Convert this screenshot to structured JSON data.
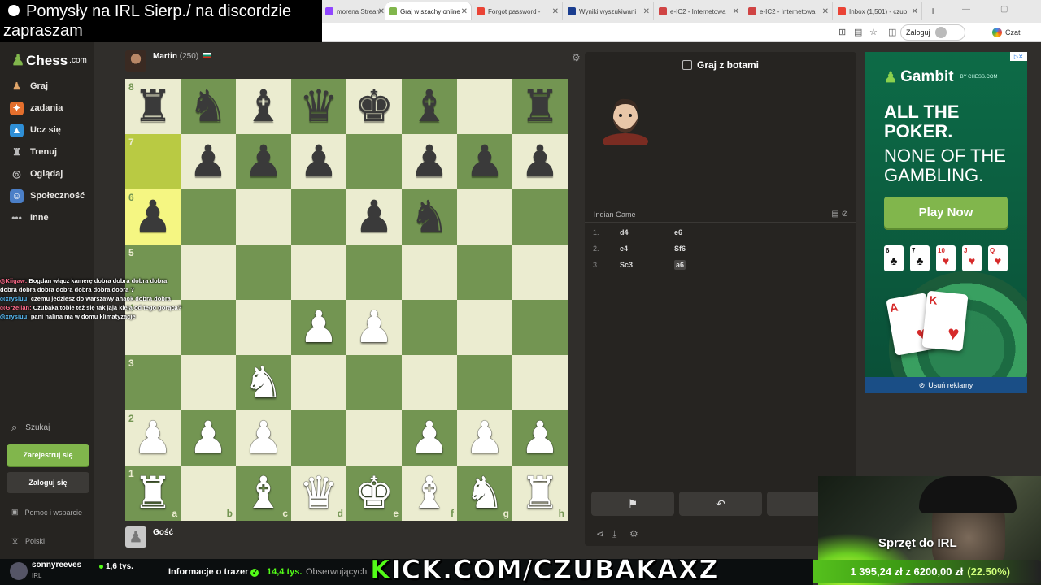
{
  "browser": {
    "tabs": [
      {
        "label": "morena Stream",
        "favicon_color": "#9146ff"
      },
      {
        "label": "Graj w szachy online",
        "favicon_color": "#81b64c",
        "active": true
      },
      {
        "label": "Forgot password - ",
        "favicon_color": "#ea4335"
      },
      {
        "label": "Wyniki wyszukiwani",
        "favicon_color": "#1a3d8f"
      },
      {
        "label": "e-IC2 - Internetowa",
        "favicon_color": "#d04444"
      },
      {
        "label": "e-IC2 - Internetowa",
        "favicon_color": "#d04444"
      },
      {
        "label": "Inbox (1,501) - czub",
        "favicon_color": "#ea4335"
      }
    ],
    "login_label": "Zaloguj",
    "chat_label": "Czat"
  },
  "stream_title": "Pomysły na IRL Sierp./ na discordzie zapraszam",
  "sidebar": {
    "logo": "Chess",
    "logo_suffix": ".com",
    "items": [
      {
        "label": "Graj",
        "color": "#e8e6e3"
      },
      {
        "label": "zadania",
        "color": "#e8e6e3"
      },
      {
        "label": "Ucz się",
        "color": "#e8e6e3"
      },
      {
        "label": "Trenuj",
        "color": "#e8e6e3"
      },
      {
        "label": "Oglądaj",
        "color": "#e8e6e3"
      },
      {
        "label": "Społeczność",
        "color": "#e8e6e3"
      },
      {
        "label": "Inne",
        "color": "#e8e6e3"
      }
    ],
    "search_label": "Szukaj",
    "register_label": "Zarejestruj się",
    "login_label": "Zaloguj się",
    "help_label": "Pomoc i wsparcie",
    "language_label": "Polski"
  },
  "game": {
    "top_player": {
      "name": "Martin",
      "rating": "(250)"
    },
    "bottom_player": {
      "name": "Gość"
    },
    "board": [
      [
        "bR",
        "bN",
        "bB",
        "bQ",
        "bK",
        "bB",
        "",
        "bR"
      ],
      [
        "",
        "bP",
        "bP",
        "bP",
        "",
        "bP",
        "bP",
        "bP"
      ],
      [
        "bP",
        "",
        "",
        "",
        "bP",
        "bN",
        "",
        ""
      ],
      [
        "",
        "",
        "",
        "",
        "",
        "",
        "",
        ""
      ],
      [
        "",
        "",
        "",
        "wP",
        "wP",
        "",
        "",
        ""
      ],
      [
        "",
        "",
        "wN",
        "",
        "",
        "",
        "",
        ""
      ],
      [
        "wP",
        "wP",
        "wP",
        "",
        "",
        "wP",
        "wP",
        "wP"
      ],
      [
        "wR",
        "",
        "wB",
        "wQ",
        "wK",
        "wB",
        "wN",
        "wR"
      ]
    ],
    "highlights": [
      "a7",
      "a6"
    ],
    "ranks": [
      "8",
      "7",
      "6",
      "5",
      "4",
      "3",
      "2",
      "1"
    ],
    "files": [
      "a",
      "b",
      "c",
      "d",
      "e",
      "f",
      "g",
      "h"
    ]
  },
  "panel": {
    "title": "Graj z botami",
    "opening": "Indian Game",
    "moves": [
      {
        "num": "1.",
        "white": "d4",
        "black": "e6"
      },
      {
        "num": "2.",
        "white": "e4",
        "black": "Sf6"
      },
      {
        "num": "3.",
        "white": "Sc3",
        "black": "a6"
      }
    ]
  },
  "chat": [
    {
      "user": "Kiigaw",
      "text": "Bogdan włącz kamerę dobra dobra dobra dobra dobra dobra dobra dobra dobra dobra dobra ?"
    },
    {
      "user": "xrysiuu",
      "text": "czemu jedziesz do warszawy ahaok dobra dobra"
    },
    {
      "user": "Grzellan",
      "text": "Czubaka tobie też się tak jaja kleją od tego gorąca?"
    },
    {
      "user": "xrysiuu",
      "text": "pani halina ma w domu klimatyzacje"
    }
  ],
  "ad": {
    "brand": "Gambit",
    "brand_sub": "BY CHESS.COM",
    "headline1": "ALL THE POKER.",
    "headline2": "NONE OF THE GAMBLING.",
    "cta": "Play Now",
    "remove": "Usuń reklamy",
    "cards": [
      {
        "rank": "6",
        "suit": "♣",
        "color": "k"
      },
      {
        "rank": "7",
        "suit": "♣",
        "color": "k"
      },
      {
        "rank": "10",
        "suit": "♥",
        "color": "r"
      },
      {
        "rank": "J",
        "suit": "♥",
        "color": "r"
      },
      {
        "rank": "Q",
        "suit": "♥",
        "color": "r"
      }
    ],
    "big_cards": [
      {
        "rank": "A",
        "suit": "♥"
      },
      {
        "rank": "K",
        "suit": "♥"
      }
    ]
  },
  "stream": {
    "streamer": "sonnyreeves",
    "streamer_sub": "IRL",
    "viewers": "1,6 tys.",
    "info_label": "Informacje o trazer",
    "followers": "14,4 tys.",
    "followers_label": "Obserwujących",
    "kick_url": "KICK.COM/CZUBAKAXZ",
    "goal_title": "Sprzęt do IRL",
    "goal_progress": "1 395,24 zł z 6200,00 zł",
    "goal_percent": "(22.50%)"
  }
}
